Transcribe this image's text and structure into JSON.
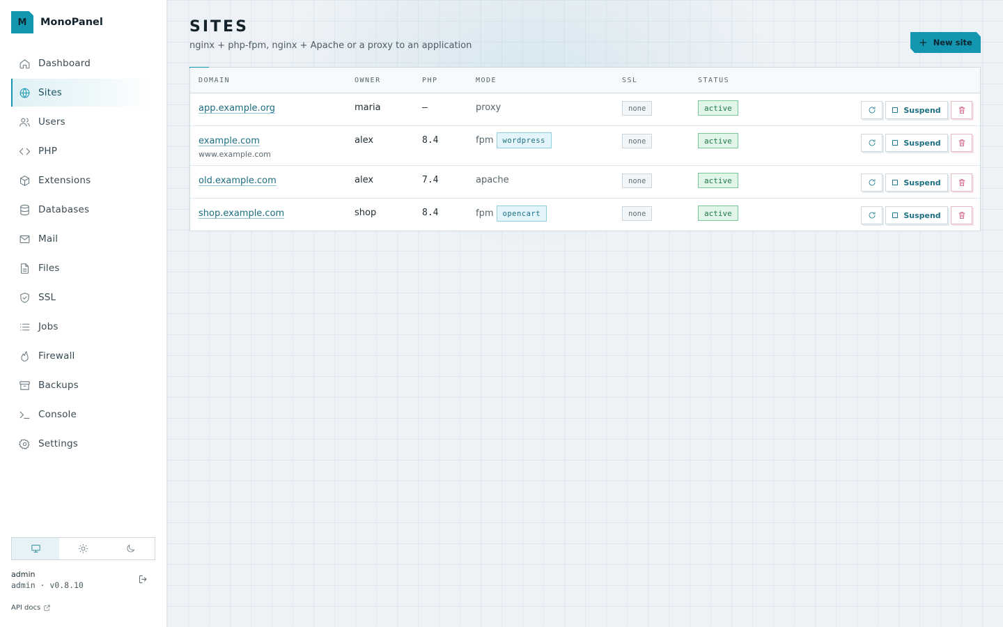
{
  "brand": {
    "logo_letter": "M",
    "name": "MonoPanel"
  },
  "nav": {
    "items": [
      {
        "label": "Dashboard",
        "icon": "home-icon",
        "active": false
      },
      {
        "label": "Sites",
        "icon": "globe-icon",
        "active": true
      },
      {
        "label": "Users",
        "icon": "users-icon",
        "active": false
      },
      {
        "label": "PHP",
        "icon": "code-icon",
        "active": false
      },
      {
        "label": "Extensions",
        "icon": "package-icon",
        "active": false
      },
      {
        "label": "Databases",
        "icon": "database-icon",
        "active": false
      },
      {
        "label": "Mail",
        "icon": "mail-icon",
        "active": false
      },
      {
        "label": "Files",
        "icon": "file-icon",
        "active": false
      },
      {
        "label": "SSL",
        "icon": "shield-icon",
        "active": false
      },
      {
        "label": "Jobs",
        "icon": "list-icon",
        "active": false
      },
      {
        "label": "Firewall",
        "icon": "flame-icon",
        "active": false
      },
      {
        "label": "Backups",
        "icon": "archive-icon",
        "active": false
      },
      {
        "label": "Console",
        "icon": "terminal-icon",
        "active": false
      },
      {
        "label": "Settings",
        "icon": "gear-icon",
        "active": false
      }
    ]
  },
  "theme": {
    "options": [
      "system",
      "light",
      "dark"
    ],
    "selected": "system"
  },
  "user": {
    "name": "admin",
    "meta": "admin · v0.8.10"
  },
  "footer": {
    "api_docs": "API docs"
  },
  "page": {
    "title": "SITES",
    "subtitle": "nginx + php-fpm, nginx + Apache or a proxy to an application",
    "new_site_label": "New site"
  },
  "table": {
    "columns": [
      "DOMAIN",
      "OWNER",
      "PHP",
      "MODE",
      "SSL",
      "STATUS"
    ],
    "suspend_label": "Suspend",
    "rows": [
      {
        "domain": "app.example.org",
        "alias": "",
        "owner": "maria",
        "php": "—",
        "mode": "proxy",
        "app": "",
        "ssl": "none",
        "status": "active"
      },
      {
        "domain": "example.com",
        "alias": "www.example.com",
        "owner": "alex",
        "php": "8.4",
        "mode": "fpm",
        "app": "wordpress",
        "ssl": "none",
        "status": "active"
      },
      {
        "domain": "old.example.com",
        "alias": "",
        "owner": "alex",
        "php": "7.4",
        "mode": "apache",
        "app": "",
        "ssl": "none",
        "status": "active"
      },
      {
        "domain": "shop.example.com",
        "alias": "",
        "owner": "shop",
        "php": "8.4",
        "mode": "fpm",
        "app": "opencart",
        "ssl": "none",
        "status": "active"
      }
    ]
  },
  "colors": {
    "accent": "#1496b1",
    "status_ok": "#1f7a45",
    "danger": "#c9386a"
  }
}
